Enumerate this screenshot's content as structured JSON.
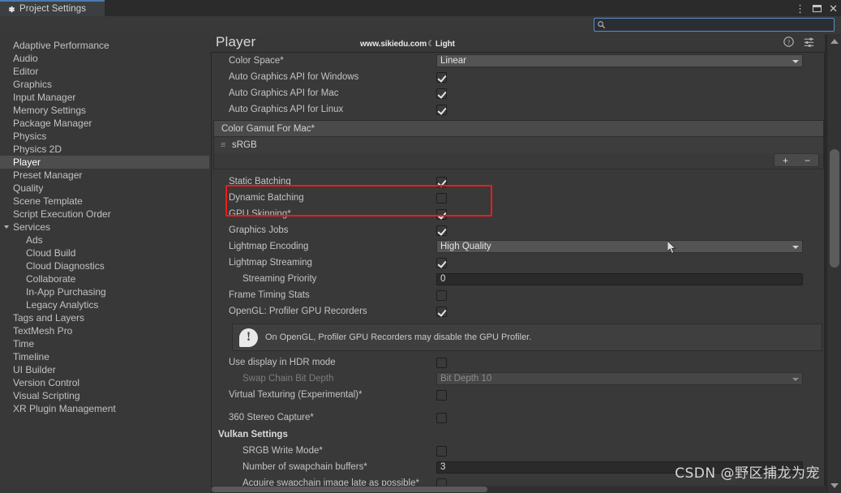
{
  "window": {
    "tab_label": "Project Settings",
    "tab_icon": "gear-icon",
    "controls": {
      "menu": "⋮",
      "maximize": "maximize-icon",
      "close": "✕"
    }
  },
  "search": {
    "placeholder": "",
    "value": "",
    "icon": "search-icon"
  },
  "sidebar": {
    "items": [
      {
        "label": "Adaptive Performance",
        "level": 0,
        "selected": false
      },
      {
        "label": "Audio",
        "level": 0,
        "selected": false
      },
      {
        "label": "Editor",
        "level": 0,
        "selected": false
      },
      {
        "label": "Graphics",
        "level": 0,
        "selected": false
      },
      {
        "label": "Input Manager",
        "level": 0,
        "selected": false
      },
      {
        "label": "Memory Settings",
        "level": 0,
        "selected": false
      },
      {
        "label": "Package Manager",
        "level": 0,
        "selected": false
      },
      {
        "label": "Physics",
        "level": 0,
        "selected": false
      },
      {
        "label": "Physics 2D",
        "level": 0,
        "selected": false
      },
      {
        "label": "Player",
        "level": 0,
        "selected": true
      },
      {
        "label": "Preset Manager",
        "level": 0,
        "selected": false
      },
      {
        "label": "Quality",
        "level": 0,
        "selected": false
      },
      {
        "label": "Scene Template",
        "level": 0,
        "selected": false
      },
      {
        "label": "Script Execution Order",
        "level": 0,
        "selected": false
      },
      {
        "label": "Services",
        "level": 0,
        "selected": false,
        "expanded": true
      },
      {
        "label": "Ads",
        "level": 1,
        "selected": false
      },
      {
        "label": "Cloud Build",
        "level": 1,
        "selected": false
      },
      {
        "label": "Cloud Diagnostics",
        "level": 1,
        "selected": false
      },
      {
        "label": "Collaborate",
        "level": 1,
        "selected": false
      },
      {
        "label": "In-App Purchasing",
        "level": 1,
        "selected": false
      },
      {
        "label": "Legacy Analytics",
        "level": 1,
        "selected": false
      },
      {
        "label": "Tags and Layers",
        "level": 0,
        "selected": false
      },
      {
        "label": "TextMesh Pro",
        "level": 0,
        "selected": false
      },
      {
        "label": "Time",
        "level": 0,
        "selected": false
      },
      {
        "label": "Timeline",
        "level": 0,
        "selected": false
      },
      {
        "label": "UI Builder",
        "level": 0,
        "selected": false
      },
      {
        "label": "Version Control",
        "level": 0,
        "selected": false
      },
      {
        "label": "Visual Scripting",
        "level": 0,
        "selected": false
      },
      {
        "label": "XR Plugin Management",
        "level": 0,
        "selected": false
      }
    ]
  },
  "panel": {
    "title": "Player",
    "watermark": "www.sikiedu.com",
    "watermark_suffix": "Light",
    "icons": [
      "help-icon",
      "preset-icon",
      "more-menu-icon"
    ]
  },
  "settings": {
    "color_space": {
      "label": "Color Space*",
      "value": "Linear"
    },
    "auto_api_windows": {
      "label": "Auto Graphics API  for Windows",
      "checked": true
    },
    "auto_api_mac": {
      "label": "Auto Graphics API  for Mac",
      "checked": true
    },
    "auto_api_linux": {
      "label": "Auto Graphics API  for Linux",
      "checked": true
    },
    "color_gamut": {
      "header": "Color Gamut For Mac*",
      "items": [
        "sRGB"
      ],
      "add_label": "+",
      "remove_label": "−"
    },
    "static_batching": {
      "label": "Static Batching",
      "checked": true,
      "highlighted": true
    },
    "dynamic_batching": {
      "label": "Dynamic Batching",
      "checked": false
    },
    "gpu_skinning": {
      "label": "GPU Skinning*",
      "checked": true
    },
    "graphics_jobs": {
      "label": "Graphics Jobs",
      "checked": true
    },
    "lightmap_encoding": {
      "label": "Lightmap Encoding",
      "value": "High Quality"
    },
    "lightmap_streaming": {
      "label": "Lightmap Streaming",
      "checked": true
    },
    "streaming_priority": {
      "label": "Streaming Priority",
      "value": "0"
    },
    "frame_timing_stats": {
      "label": "Frame Timing Stats",
      "checked": false
    },
    "opengl_profiler": {
      "label": "OpenGL: Profiler GPU Recorders",
      "checked": true
    },
    "help_message": "On OpenGL, Profiler GPU Recorders may disable the GPU Profiler.",
    "hdr_mode": {
      "label": "Use display in HDR mode",
      "checked": false
    },
    "swap_chain_bit_depth": {
      "label": "Swap Chain Bit Depth",
      "value": "Bit Depth 10",
      "disabled": true
    },
    "virtual_texturing": {
      "label": "Virtual Texturing (Experimental)*",
      "checked": false
    },
    "stereo_capture": {
      "label": "360 Stereo Capture*",
      "checked": false
    },
    "vulkan_header": "Vulkan Settings",
    "srgb_write_mode": {
      "label": "SRGB Write Mode*",
      "checked": false
    },
    "swapchain_buffers": {
      "label": "Number of swapchain buffers*",
      "value": "3"
    },
    "acquire_swapchain": {
      "label": "Acquire swapchain image late as possible*",
      "checked": false
    }
  },
  "annotation": {
    "color": "#f01a1a",
    "target": "Static Batching"
  },
  "credit": "CSDN @野区捕龙为宠"
}
